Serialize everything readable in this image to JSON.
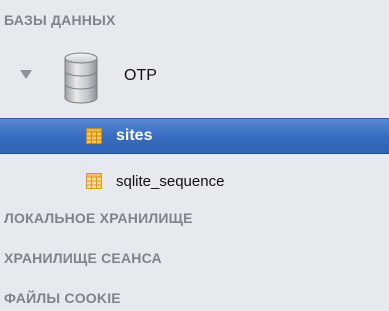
{
  "sidebar": {
    "databases_header": "БАЗЫ ДАННЫХ",
    "database": {
      "name": "OTP",
      "expanded": true,
      "icon": "database-icon",
      "tables": [
        {
          "name": "sites",
          "selected": true,
          "icon": "table-icon"
        },
        {
          "name": "sqlite_sequence",
          "selected": false,
          "icon": "table-icon"
        }
      ]
    },
    "local_storage_header": "ЛОКАЛЬНОЕ ХРАНИЛИЩЕ",
    "session_storage_header": "ХРАНИЛИЩЕ СЕАНСА",
    "cookies_header": "ФАЙЛЫ COOKIE"
  },
  "colors": {
    "background": "#e6eaef",
    "header_text": "#7e848c",
    "selection": "#3a6fc2",
    "table_icon": "#f3b533"
  }
}
